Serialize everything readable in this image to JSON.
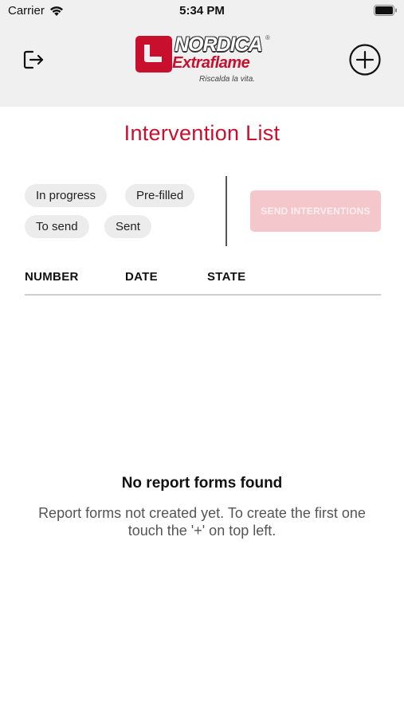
{
  "status_bar": {
    "carrier": "Carrier",
    "time": "5:34 PM"
  },
  "header": {
    "logout_icon": "logout-icon",
    "add_icon": "plus-circle-icon",
    "logo": {
      "brand": "NORDICA",
      "sub": "Extraflame",
      "tagline": "Riscalda la vita.",
      "registered": "®"
    }
  },
  "page": {
    "title": "Intervention List"
  },
  "filters": [
    {
      "label": "In progress"
    },
    {
      "label": "Pre-filled"
    },
    {
      "label": "To send"
    },
    {
      "label": "Sent"
    }
  ],
  "actions": {
    "send_label": "SEND INTERVENTIONS"
  },
  "table": {
    "columns": [
      "NUMBER",
      "DATE",
      "STATE"
    ],
    "rows": []
  },
  "empty_state": {
    "title": "No report forms found",
    "message": "Report forms not created yet. To create the first one touch the '+' on top left."
  },
  "colors": {
    "accent": "#c8102e",
    "header_bg": "#f0f0f0",
    "chip_bg": "#ececec",
    "send_disabled_bg": "#f4c7cc"
  }
}
